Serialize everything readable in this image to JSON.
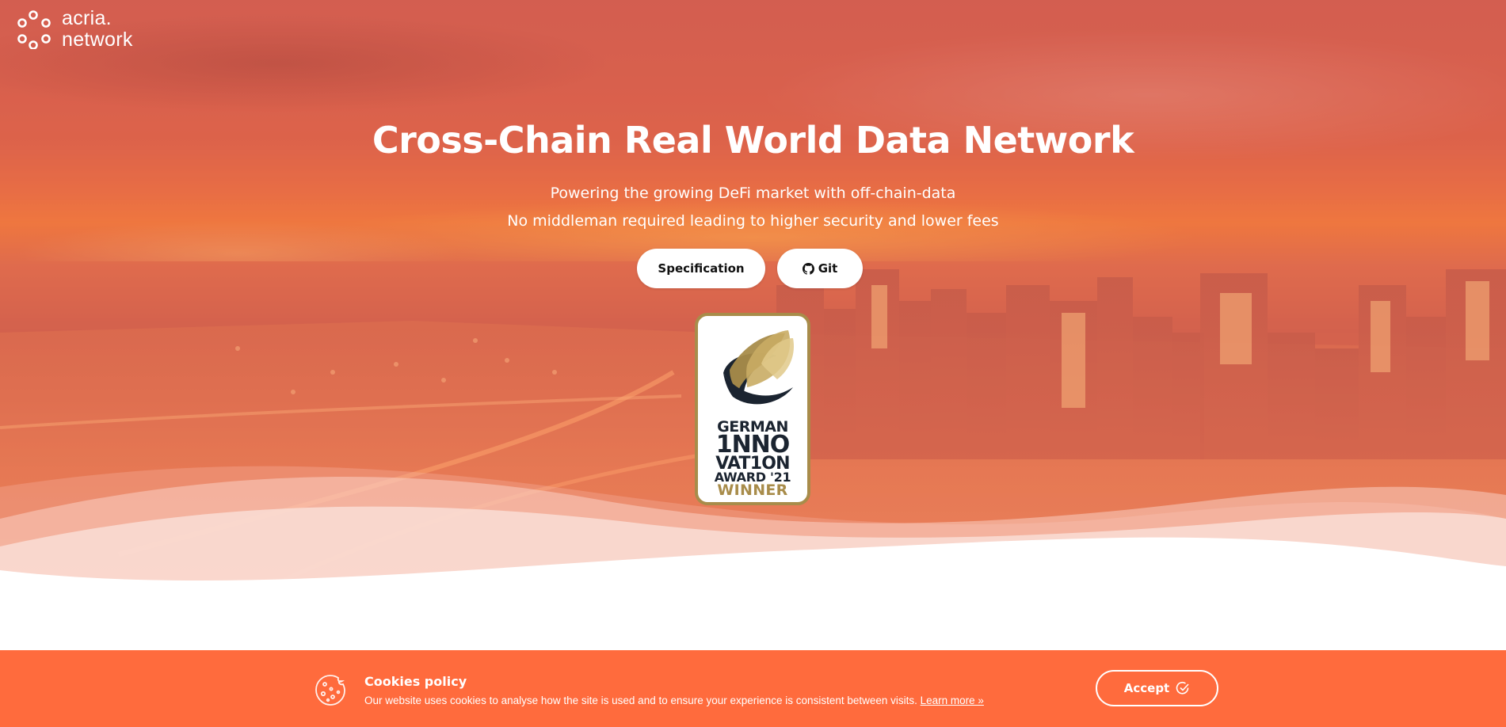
{
  "logo": {
    "line1": "acria.",
    "line2": "network",
    "icon": "dots-logo-icon"
  },
  "hero": {
    "title": "Cross-Chain Real World Data Network",
    "subtitle1": "Powering the growing DeFi market with off-chain-data",
    "subtitle2": "No middleman required leading to higher security and lower fees",
    "buttons": {
      "specification": "Specification",
      "git": "Git",
      "git_icon": "github-icon"
    },
    "award": {
      "line1": "GERMAN",
      "line2": "1NNO",
      "line3": "VAT1ON",
      "line4": "AWARD '21",
      "line5": "WINNER",
      "colors": {
        "gold": "#a88c4a",
        "navy": "#1b2430"
      }
    }
  },
  "cookie": {
    "title": "Cookies policy",
    "description": "Our website uses cookies to analyse how the site is used and to ensure your experience is consistent between visits.",
    "learn_more": "Learn more »",
    "accept": "Accept",
    "icon": "cookie-icon",
    "accept_icon": "check-circle-icon",
    "bar_color": "#ff6b3d"
  }
}
